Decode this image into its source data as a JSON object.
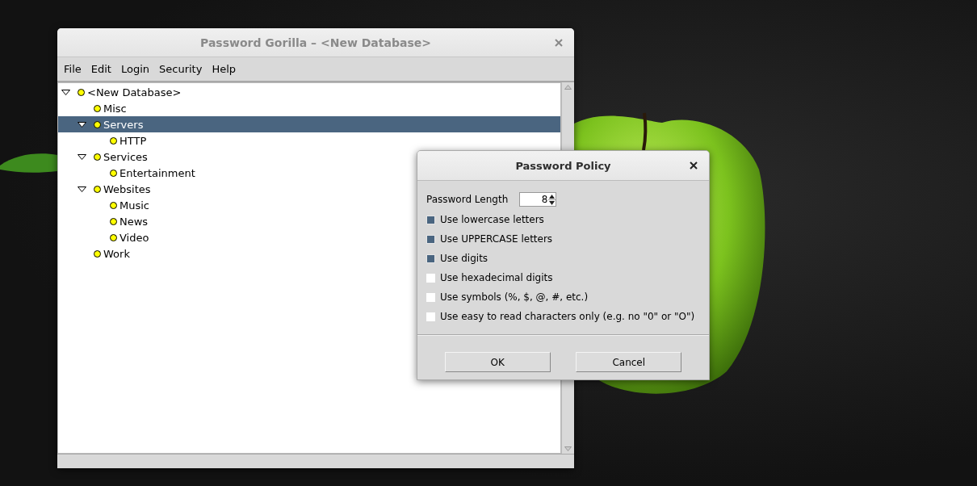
{
  "main_window": {
    "title": "Password Gorilla – <New Database>",
    "menu": [
      "File",
      "Edit",
      "Login",
      "Security",
      "Help"
    ],
    "tree": [
      {
        "label": "<New Database>",
        "expanded": true,
        "selected": false,
        "children": [
          {
            "label": "Misc",
            "selected": false
          },
          {
            "label": "Servers",
            "expanded": true,
            "selected": true,
            "children": [
              {
                "label": "HTTP",
                "selected": false
              }
            ]
          },
          {
            "label": "Services",
            "expanded": true,
            "selected": false,
            "children": [
              {
                "label": "Entertainment",
                "selected": false
              }
            ]
          },
          {
            "label": "Websites",
            "expanded": true,
            "selected": false,
            "children": [
              {
                "label": "Music",
                "selected": false
              },
              {
                "label": "News",
                "selected": false
              },
              {
                "label": "Video",
                "selected": false
              }
            ]
          },
          {
            "label": "Work",
            "selected": false
          }
        ]
      }
    ]
  },
  "dialog": {
    "title": "Password Policy",
    "length_label": "Password Length",
    "length_value": "8",
    "options": [
      {
        "label": "Use lowercase letters",
        "checked": true
      },
      {
        "label": "Use UPPERCASE letters",
        "checked": true
      },
      {
        "label": "Use digits",
        "checked": true
      },
      {
        "label": "Use hexadecimal digits",
        "checked": false
      },
      {
        "label": "Use symbols (%, $, @, #, etc.)",
        "checked": false
      },
      {
        "label": "Use easy to read characters only (e.g. no \"0\" or \"O\")",
        "checked": false
      }
    ],
    "buttons": [
      "OK",
      "Cancel"
    ]
  }
}
